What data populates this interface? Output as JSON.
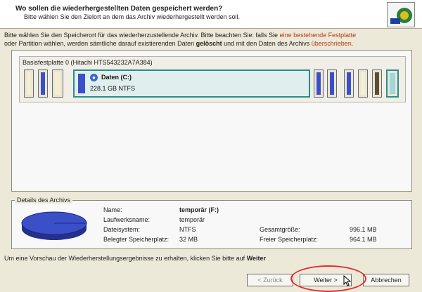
{
  "header": {
    "title": "Wo sollen die wiederhergestellten Daten gespeichert werden?",
    "subtitle": "Bitte wählen Sie den Zielort an dem das Archiv wiederhergestellt werden soll."
  },
  "instruction": {
    "part1": "Bitte wählen Sie den Speicherort für das wiederherzustellende Archiv. Bitte beachten Sie: falls Sie",
    "part1_red": " eine bestehende Festplatte",
    "part2": "oder Partition wählen, werden sämtliche darauf existierenden Daten ",
    "bold": "gelöscht",
    "part3": " und mit den Daten des Archivs ",
    "part3_red": "überschrieben."
  },
  "disk": {
    "label": "Basisfestplatte 0 (Hitachi HTS543232A7A384)",
    "selected_partition": {
      "name": "Daten (C:)",
      "size": "228.1 GB NTFS"
    }
  },
  "details": {
    "legend": "Details des Archivs",
    "name_label": "Name:",
    "name_value": "temporär (F:)",
    "drive_label": "Laufwerksname:",
    "drive_value": "temporär",
    "fs_label": "Dateisystem:",
    "fs_value": "NTFS",
    "used_label": "Belegter Speicherplatz:",
    "used_value": "32 MB",
    "total_label": "Gesamtgröße:",
    "total_value": "996.1 MB",
    "free_label": "Freier Speicherplatz:",
    "free_value": "964.1 MB"
  },
  "hint": {
    "text": "Um eine Vorschau der Wiederherstellungsergebnisse zu erhalten, klicken Sie bitte auf ",
    "bold": "Weiter"
  },
  "buttons": {
    "back": "< Zurück",
    "next": "Weiter >",
    "cancel": "Abbrechen"
  },
  "colors": {
    "accent": "#2b8d8b",
    "partition_blue": "#3b4fc8",
    "warning_red": "#b53a1c",
    "highlight_circle": "#e03030"
  }
}
